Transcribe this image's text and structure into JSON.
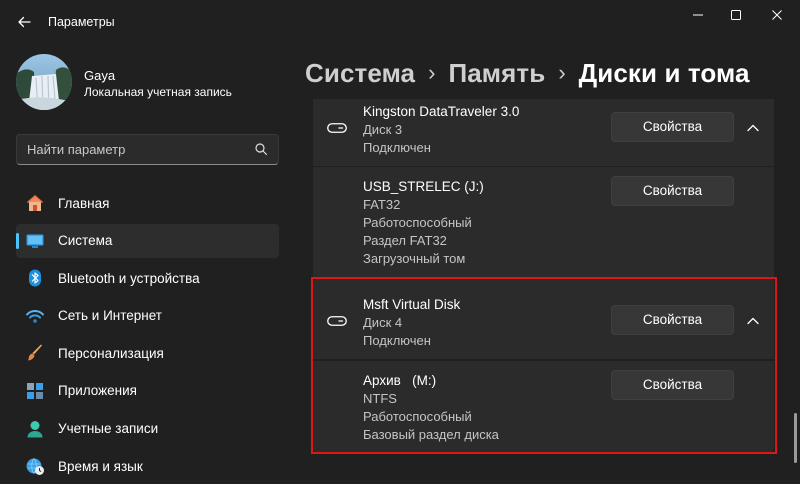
{
  "app": {
    "title": "Параметры"
  },
  "user": {
    "name": "Gaya",
    "account_type": "Локальная учетная запись"
  },
  "search": {
    "placeholder": "Найти параметр"
  },
  "nav": [
    {
      "label": "Главная",
      "icon": "home-icon"
    },
    {
      "label": "Система",
      "icon": "system-display-icon",
      "active": true
    },
    {
      "label": "Bluetooth и устройства",
      "icon": "bluetooth-icon"
    },
    {
      "label": "Сеть и Интернет",
      "icon": "wifi-icon"
    },
    {
      "label": "Персонализация",
      "icon": "brush-icon"
    },
    {
      "label": "Приложения",
      "icon": "apps-icon"
    },
    {
      "label": "Учетные записи",
      "icon": "account-icon"
    },
    {
      "label": "Время и язык",
      "icon": "globe-clock-icon"
    }
  ],
  "breadcrumb": [
    "Система",
    "Память",
    "Диски и тома"
  ],
  "disks": [
    {
      "name": "Kingston DataTraveler 3.0",
      "number": "Диск 3",
      "status": "Подключен",
      "button": "Свойства",
      "volume": {
        "name": "USB_STRELEC (J:)",
        "fs": "FAT32",
        "health": "Работоспособный",
        "partition": "Раздел FAT32",
        "type": "Загрузочный том",
        "button": "Свойства"
      }
    },
    {
      "name": "Msft Virtual Disk",
      "number": "Диск 4",
      "status": "Подключен",
      "button": "Свойства",
      "volume": {
        "name": "Архив   (M:)",
        "fs": "NTFS",
        "health": "Работоспособный",
        "partition": "Базовый раздел диска",
        "button": "Свойства"
      }
    }
  ],
  "colors": {
    "accent": "#4cc2ff",
    "highlight": "#e01515",
    "background": "#202020",
    "card": "#2b2b2b"
  }
}
